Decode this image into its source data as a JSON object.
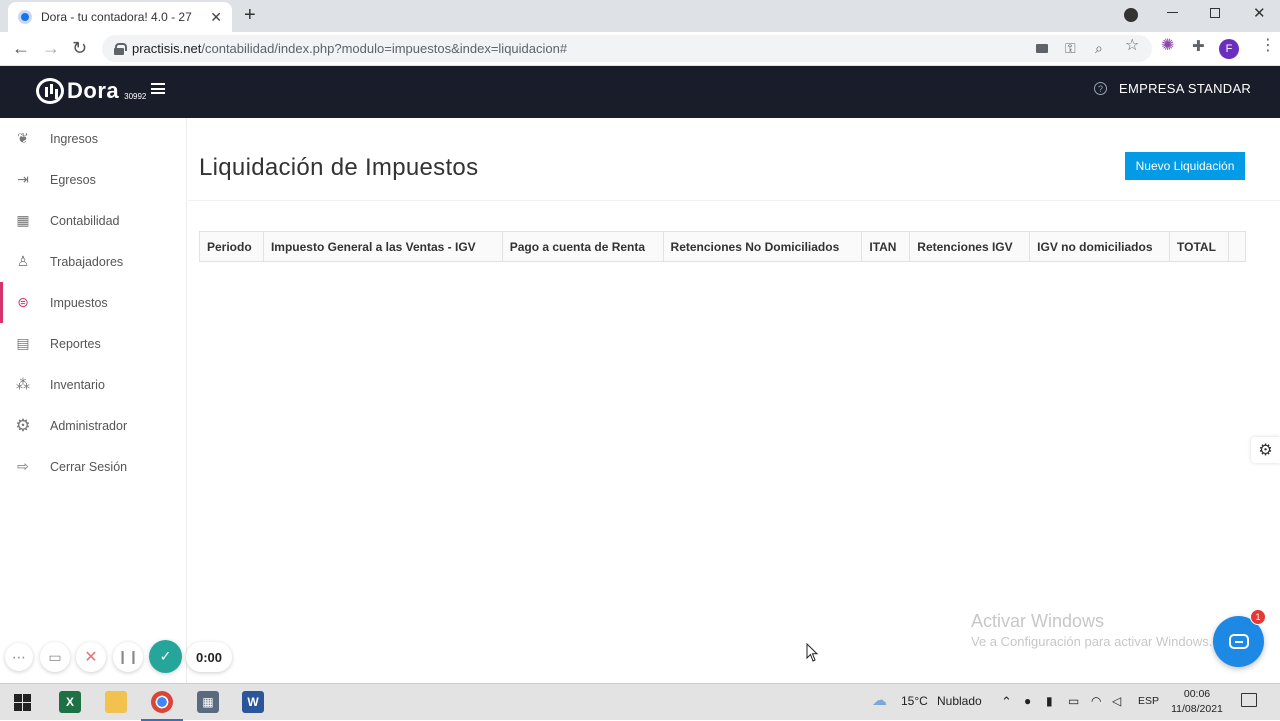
{
  "browser": {
    "tab_title": "Dora - tu contadora! 4.0 - 27",
    "tab_close": "✕",
    "new_tab": "+",
    "url_host": "practisis.net",
    "url_path": "/contabilidad/index.php?modulo=impuestos&index=liquidacion#",
    "profile_initial": "F"
  },
  "header": {
    "logo_text": "Dora",
    "logo_code": "30992",
    "company": "EMPRESA STANDAR",
    "help_glyph": "?"
  },
  "sidebar": {
    "items": [
      {
        "label": "Ingresos",
        "icon": "money-hand-icon"
      },
      {
        "label": "Egresos",
        "icon": "cash-out-icon"
      },
      {
        "label": "Contabilidad",
        "icon": "calculator-icon"
      },
      {
        "label": "Trabajadores",
        "icon": "workers-icon"
      },
      {
        "label": "Impuestos",
        "icon": "tax-icon",
        "active": true
      },
      {
        "label": "Reportes",
        "icon": "report-icon"
      },
      {
        "label": "Inventario",
        "icon": "inventory-icon"
      },
      {
        "label": "Administrador",
        "icon": "gear-icon"
      },
      {
        "label": "Cerrar Sesión",
        "icon": "logout-icon"
      }
    ]
  },
  "main": {
    "title": "Liquidación de Impuestos",
    "new_button": "Nuevo Liquidación",
    "table": {
      "columns": [
        "Periodo",
        "Impuesto General a las Ventas - IGV",
        "Pago a cuenta de Renta",
        "Retenciones No Domiciliados",
        "ITAN",
        "Retenciones IGV",
        "IGV no domiciliados",
        "TOTAL",
        ""
      ]
    }
  },
  "overlay": {
    "watermark_title": "Activar Windows",
    "watermark_sub": "Ve a Configuración para activar Windows.",
    "chat_badge": "1"
  },
  "recorder": {
    "timer": "0:00"
  },
  "taskbar": {
    "weather_temp": "15°C",
    "weather_text": "Nublado",
    "language": "ESP",
    "time": "00:06",
    "date": "11/08/2021"
  },
  "colors": {
    "header_bg": "#181d29",
    "accent_button": "#039be5",
    "active_indicator": "#d6336c"
  }
}
